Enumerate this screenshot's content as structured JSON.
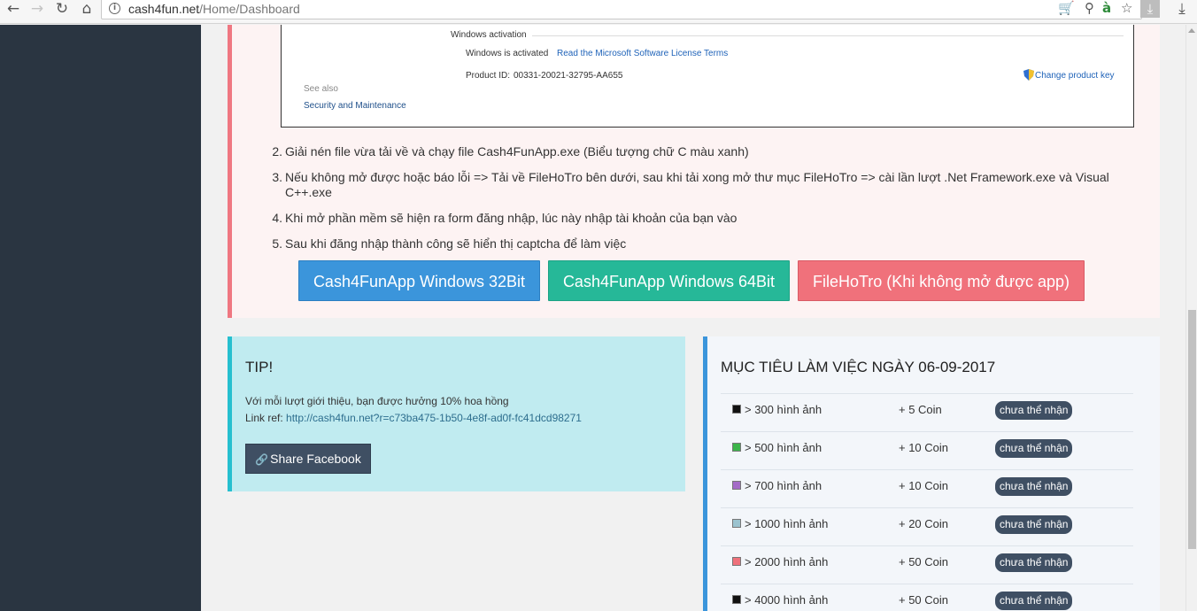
{
  "browser": {
    "back_glyph": "←",
    "forward_glyph": "→",
    "reload_glyph": "↻",
    "home_glyph": "⌂",
    "info_glyph": "i",
    "url_host": "cash4fun.net",
    "url_path": "/Home/Dashboard",
    "cart_glyph": "🛒",
    "pin_glyph": "⚲",
    "a_glyph": "à",
    "star_glyph": "☆",
    "download_glyph": "⤓",
    "menu_download_glyph": "⤓"
  },
  "activation": {
    "heading": "Windows activation",
    "status": "Windows is activated",
    "license_link": "Read the Microsoft Software License Terms",
    "product_id_label": "Product ID:",
    "product_id": "00331-20021-32795-AA655",
    "change_key_link": "Change product key",
    "see_also": "See also",
    "security_link": "Security and Maintenance"
  },
  "steps": [
    {
      "num": "2.",
      "text": "Giải nén file vừa tải về và chạy file Cash4FunApp.exe (Biểu tượng chữ C màu xanh)"
    },
    {
      "num": "3.",
      "text": "Nếu không mở được hoặc báo lỗi => Tải về FileHoTro bên dưới, sau khi tải xong mở thư mục FileHoTro => cài lần lượt .Net Framework.exe và Visual C++.exe"
    },
    {
      "num": "4.",
      "text": "Khi mở phần mềm sẽ hiện ra form đăng nhập, lúc này nhập tài khoản của bạn vào"
    },
    {
      "num": "5.",
      "text": "Sau khi đăng nhập thành công sẽ hiển thị captcha để làm việc"
    }
  ],
  "buttons": {
    "win32": "Cash4FunApp Windows 32Bit",
    "win64": "Cash4FunApp Windows 64Bit",
    "hotro": "FileHoTro (Khi không mở được app)"
  },
  "tip": {
    "title": "TIP!",
    "text": "Với mỗi lượt giới thiệu, bạn được hưởng 10% hoa hồng",
    "ref_label": "Link ref:",
    "ref_url": "http://cash4fun.net?r=c73ba475-1b50-4e8f-ad0f-fc41dcd98271",
    "share_label": "Share Facebook",
    "link_glyph": "🔗"
  },
  "goals": {
    "title": "MỤC TIÊU LÀM VIỆC NGÀY 06-09-2017",
    "rows": [
      {
        "label": "> 300 hình ảnh",
        "reward": "+ 5 Coin",
        "status": "chưa thể nhận",
        "color": "#111111"
      },
      {
        "label": "> 500 hình ảnh",
        "reward": "+ 10 Coin",
        "status": "chưa thể nhận",
        "color": "#3cb54a"
      },
      {
        "label": "> 700 hình ảnh",
        "reward": "+ 10 Coin",
        "status": "chưa thể nhận",
        "color": "#a46bc7"
      },
      {
        "label": "> 1000 hình ảnh",
        "reward": "+ 20 Coin",
        "status": "chưa thể nhận",
        "color": "#9bc3cf"
      },
      {
        "label": "> 2000 hình ảnh",
        "reward": "+ 50 Coin",
        "status": "chưa thể nhận",
        "color": "#ef717b"
      },
      {
        "label": "> 4000 hình ảnh",
        "reward": "+ 50 Coin",
        "status": "chưa thể nhận",
        "color": "#111111"
      }
    ]
  },
  "colors": {
    "sidebar": "#2a3541",
    "danger": "#ef7781",
    "info": "#26bfcf",
    "primary": "#3b95db",
    "success": "#26b898",
    "badge": "#3f4f63"
  }
}
